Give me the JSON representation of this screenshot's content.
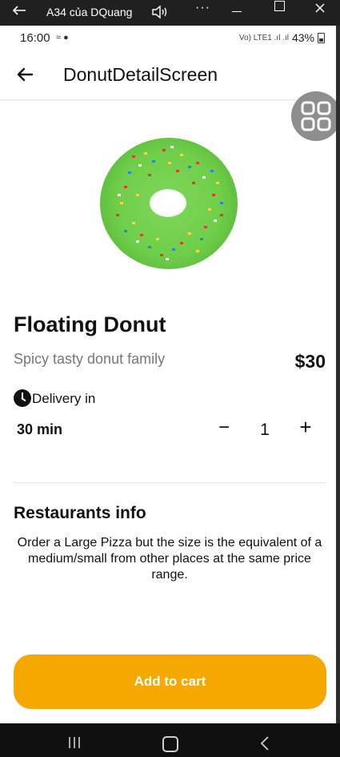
{
  "window": {
    "title": "A34 của DQuang",
    "more": "···"
  },
  "status_bar": {
    "time": "16:00",
    "left_icons": "≈ ●",
    "right_text": "Vo) LTE1 .ıl .ıl",
    "battery": "43%"
  },
  "app_bar": {
    "title": "DonutDetailScreen"
  },
  "product": {
    "name": "Floating Donut",
    "subtitle": "Spicy tasty donut family",
    "price": "$30",
    "delivery_label": "Delivery in",
    "delivery_time": "30 min",
    "quantity": "1",
    "minus": "−",
    "plus": "+"
  },
  "info": {
    "title": "Restaurants info",
    "description": "Order a Large Pizza but the size is the equivalent of a medium/small from other places at the same price range."
  },
  "cart_button": {
    "label": "Add to cart"
  },
  "colors": {
    "accent": "#f5a800",
    "donut": "#6fcf49",
    "fab": "#8e8e8e"
  }
}
